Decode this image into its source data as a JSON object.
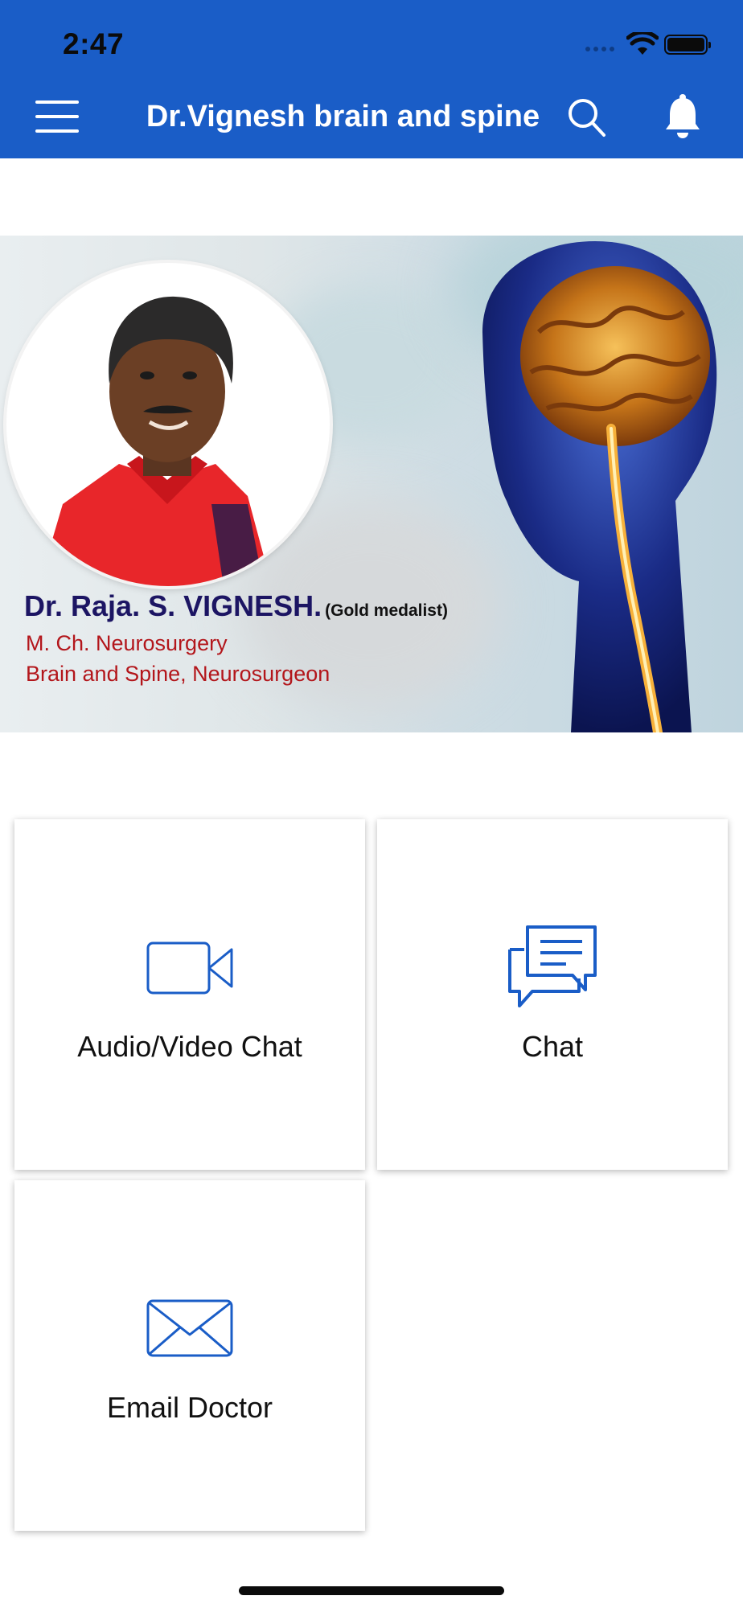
{
  "status_bar": {
    "time": "2:47"
  },
  "appbar": {
    "title": "Dr.Vignesh brain and spine",
    "background": "#1a5dc7",
    "icons": [
      "menu-icon",
      "search-icon",
      "bell-icon"
    ]
  },
  "banner": {
    "doctor_name": "Dr. Raja. S. VIGNESH.",
    "honor": "(Gold medalist)",
    "qualification": "M. Ch. Neurosurgery",
    "specialty": "Brain and Spine, Neurosurgeon"
  },
  "tiles": [
    {
      "label": "Audio/Video Chat",
      "icon": "video-camera-icon"
    },
    {
      "label": "Chat",
      "icon": "chat-bubbles-icon"
    },
    {
      "label": "Email Doctor",
      "icon": "envelope-icon"
    }
  ],
  "colors": {
    "accent": "#1a5dc7",
    "name_text": "#1c1563",
    "subtitle_text": "#b3161b"
  }
}
